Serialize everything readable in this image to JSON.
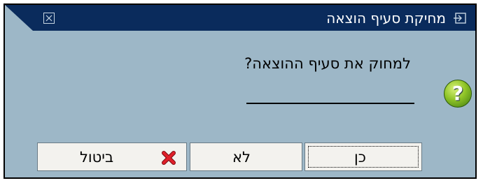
{
  "dialog": {
    "title": "מחיקת סעיף הוצאה",
    "close_icon": "close-icon",
    "system_icon": "window-menu-icon",
    "question": "למחוק את סעיף ההוצאה?",
    "help_icon": "question-mark-icon",
    "help_glyph": "?"
  },
  "buttons": {
    "yes_label": "כן",
    "no_label": "לא",
    "cancel_label": "ביטול",
    "cancel_icon": "red-x-icon"
  },
  "colors": {
    "title_bar": "#0a2b5c",
    "dialog_background": "#9db7c7",
    "button_face": "#f3f2ee",
    "help_icon": "#7fbf2a",
    "cancel_icon": "#e0202a"
  }
}
